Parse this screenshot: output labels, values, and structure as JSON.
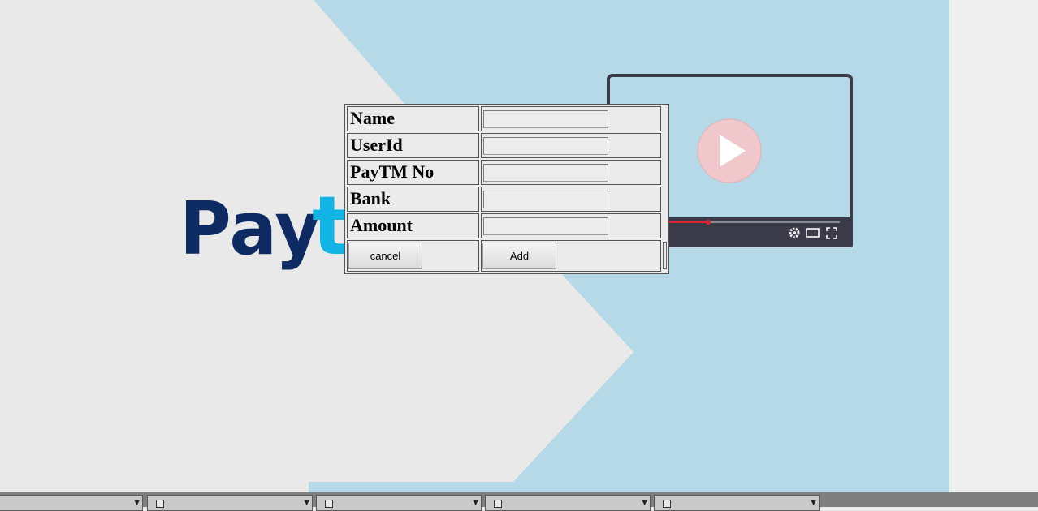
{
  "form": {
    "rows": [
      {
        "label": "Name",
        "value": ""
      },
      {
        "label": "UserId",
        "value": ""
      },
      {
        "label": "PayTM No",
        "value": ""
      },
      {
        "label": "Bank",
        "value": ""
      },
      {
        "label": "Amount",
        "value": ""
      }
    ],
    "cancel_label": "cancel",
    "add_label": "Add"
  },
  "logo": {
    "text_dark": "Pay",
    "text_light": "t"
  },
  "colors": {
    "page_bg": "#e9e9e9",
    "panel_blue": "#b6d9e7",
    "logo_navy": "#0d2b62",
    "logo_cyan": "#12b4e6",
    "video_frame": "#3a3a48",
    "play_circle": "#f0c8cc",
    "progress_red": "#d6262f",
    "taskbar": "#7f7f7f"
  },
  "icons": [
    "play-icon",
    "settings-icon",
    "theater-mode-icon",
    "fullscreen-icon"
  ],
  "taskbar": {
    "item_count": 5
  }
}
